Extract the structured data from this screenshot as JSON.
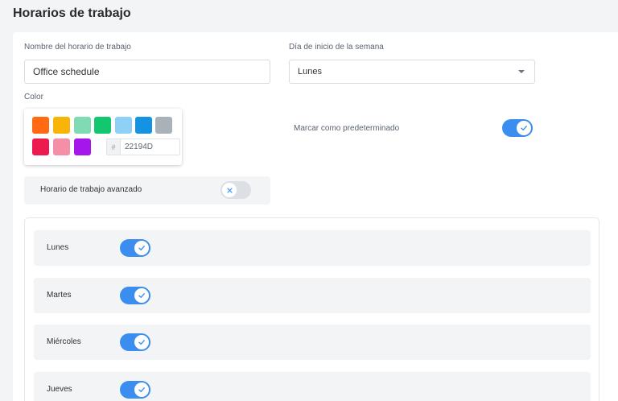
{
  "page": {
    "title": "Horarios de trabajo"
  },
  "form": {
    "name_label": "Nombre del horario de trabajo",
    "name_value": "Office schedule",
    "week_start_label": "Día de inicio de la semana",
    "week_start_value": "Lunes",
    "color_label": "Color",
    "hex_prefix": "#",
    "hex_value": "22194D",
    "default_label": "Marcar como predeterminado",
    "default_checked": true,
    "advanced_label": "Horario de trabajo avanzado",
    "advanced_checked": false
  },
  "swatches": [
    "#ff6a13",
    "#f9b40a",
    "#7fdbb4",
    "#12c76f",
    "#8fd0f7",
    "#1592e2",
    "#a9b1b9",
    "#ec1a4e",
    "#f58fa7",
    "#a516ec"
  ],
  "days": [
    {
      "label": "Lunes",
      "enabled": true
    },
    {
      "label": "Martes",
      "enabled": true
    },
    {
      "label": "Miércoles",
      "enabled": true
    },
    {
      "label": "Jueves",
      "enabled": true
    }
  ],
  "colors": {
    "accent": "#3b8ef0",
    "toggle_off": "#dcdfe3"
  },
  "icons": {
    "toggle_on": "check-icon",
    "toggle_off": "x-icon",
    "select": "caret-down-icon"
  }
}
